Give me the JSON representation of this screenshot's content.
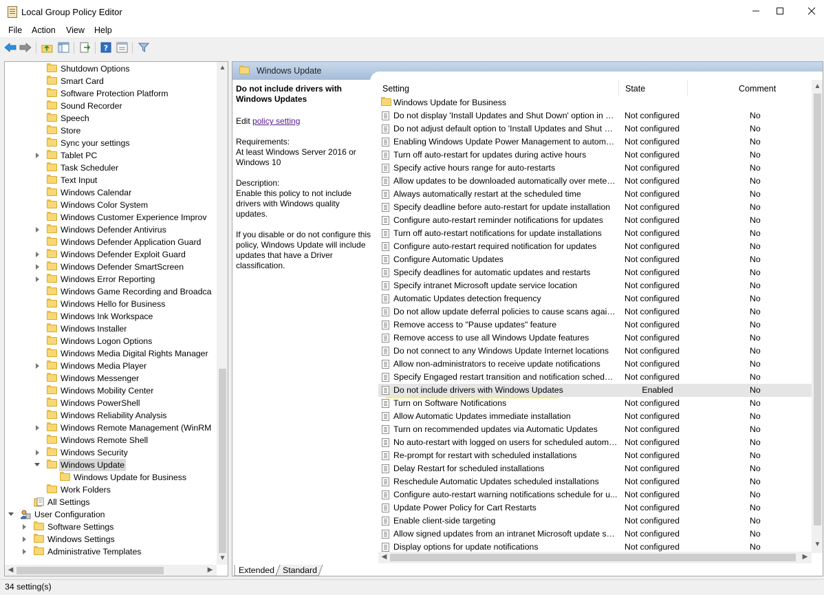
{
  "window": {
    "title": "Local Group Policy Editor"
  },
  "menu": [
    "File",
    "Action",
    "View",
    "Help"
  ],
  "toolbar_icons": [
    "back-arrow-icon",
    "forward-arrow-icon",
    "folder-up-icon",
    "show-hide-tree-icon",
    "export-list-icon",
    "help-icon",
    "properties-icon",
    "filter-icon"
  ],
  "tree": [
    {
      "label": "Shutdown Options",
      "depth": 2,
      "exp": "none"
    },
    {
      "label": "Smart Card",
      "depth": 2,
      "exp": "none"
    },
    {
      "label": "Software Protection Platform",
      "depth": 2,
      "exp": "none"
    },
    {
      "label": "Sound Recorder",
      "depth": 2,
      "exp": "none"
    },
    {
      "label": "Speech",
      "depth": 2,
      "exp": "none"
    },
    {
      "label": "Store",
      "depth": 2,
      "exp": "none"
    },
    {
      "label": "Sync your settings",
      "depth": 2,
      "exp": "none"
    },
    {
      "label": "Tablet PC",
      "depth": 2,
      "exp": "closed"
    },
    {
      "label": "Task Scheduler",
      "depth": 2,
      "exp": "none"
    },
    {
      "label": "Text Input",
      "depth": 2,
      "exp": "none"
    },
    {
      "label": "Windows Calendar",
      "depth": 2,
      "exp": "none"
    },
    {
      "label": "Windows Color System",
      "depth": 2,
      "exp": "none"
    },
    {
      "label": "Windows Customer Experience Improv",
      "depth": 2,
      "exp": "none"
    },
    {
      "label": "Windows Defender Antivirus",
      "depth": 2,
      "exp": "closed"
    },
    {
      "label": "Windows Defender Application Guard",
      "depth": 2,
      "exp": "none"
    },
    {
      "label": "Windows Defender Exploit Guard",
      "depth": 2,
      "exp": "closed"
    },
    {
      "label": "Windows Defender SmartScreen",
      "depth": 2,
      "exp": "closed"
    },
    {
      "label": "Windows Error Reporting",
      "depth": 2,
      "exp": "closed"
    },
    {
      "label": "Windows Game Recording and Broadca",
      "depth": 2,
      "exp": "none"
    },
    {
      "label": "Windows Hello for Business",
      "depth": 2,
      "exp": "none"
    },
    {
      "label": "Windows Ink Workspace",
      "depth": 2,
      "exp": "none"
    },
    {
      "label": "Windows Installer",
      "depth": 2,
      "exp": "none"
    },
    {
      "label": "Windows Logon Options",
      "depth": 2,
      "exp": "none"
    },
    {
      "label": "Windows Media Digital Rights Manager",
      "depth": 2,
      "exp": "none"
    },
    {
      "label": "Windows Media Player",
      "depth": 2,
      "exp": "closed"
    },
    {
      "label": "Windows Messenger",
      "depth": 2,
      "exp": "none"
    },
    {
      "label": "Windows Mobility Center",
      "depth": 2,
      "exp": "none"
    },
    {
      "label": "Windows PowerShell",
      "depth": 2,
      "exp": "none"
    },
    {
      "label": "Windows Reliability Analysis",
      "depth": 2,
      "exp": "none"
    },
    {
      "label": "Windows Remote Management (WinRM",
      "depth": 2,
      "exp": "closed"
    },
    {
      "label": "Windows Remote Shell",
      "depth": 2,
      "exp": "none"
    },
    {
      "label": "Windows Security",
      "depth": 2,
      "exp": "closed"
    },
    {
      "label": "Windows Update",
      "depth": 2,
      "exp": "open",
      "selected": true
    },
    {
      "label": "Windows Update for Business",
      "depth": 3,
      "exp": "none"
    },
    {
      "label": "Work Folders",
      "depth": 2,
      "exp": "none"
    },
    {
      "label": "All Settings",
      "depth": 1,
      "exp": "none",
      "icon": "settings"
    },
    {
      "label": "User Configuration",
      "depth": 0,
      "exp": "open",
      "icon": "user"
    },
    {
      "label": "Software Settings",
      "depth": 1,
      "exp": "closed"
    },
    {
      "label": "Windows Settings",
      "depth": 1,
      "exp": "closed"
    },
    {
      "label": "Administrative Templates",
      "depth": 1,
      "exp": "closed"
    }
  ],
  "right": {
    "header": "Windows Update",
    "extended": {
      "title": "Do not include drivers with Windows Updates",
      "edit_prefix": "Edit ",
      "edit_link": "policy setting ",
      "requirements_label": "Requirements:",
      "requirements": "At least Windows Server 2016 or Windows 10",
      "description_label": "Description:",
      "description": "Enable this policy to not include drivers with Windows quality updates.",
      "description2": "If you disable or do not configure this policy, Windows Update will include updates that have a Driver classification."
    },
    "columns": {
      "setting": "Setting",
      "state": "State",
      "comment": "Comment"
    },
    "folder_row": "Windows Update for Business",
    "rows": [
      {
        "name": "Do not display 'Install Updates and Shut Down' option in Sh...",
        "state": "Not configured",
        "comment": "No"
      },
      {
        "name": "Do not adjust default option to 'Install Updates and Shut Do...",
        "state": "Not configured",
        "comment": "No"
      },
      {
        "name": "Enabling Windows Update Power Management to automati...",
        "state": "Not configured",
        "comment": "No"
      },
      {
        "name": "Turn off auto-restart for updates during active hours",
        "state": "Not configured",
        "comment": "No"
      },
      {
        "name": "Specify active hours range for auto-restarts",
        "state": "Not configured",
        "comment": "No"
      },
      {
        "name": "Allow updates to be downloaded automatically over metere...",
        "state": "Not configured",
        "comment": "No"
      },
      {
        "name": "Always automatically restart at the scheduled time",
        "state": "Not configured",
        "comment": "No"
      },
      {
        "name": "Specify deadline before auto-restart for update installation",
        "state": "Not configured",
        "comment": "No"
      },
      {
        "name": "Configure auto-restart reminder notifications for updates",
        "state": "Not configured",
        "comment": "No"
      },
      {
        "name": "Turn off auto-restart notifications for update installations",
        "state": "Not configured",
        "comment": "No"
      },
      {
        "name": "Configure auto-restart required notification for updates",
        "state": "Not configured",
        "comment": "No"
      },
      {
        "name": "Configure Automatic Updates",
        "state": "Not configured",
        "comment": "No"
      },
      {
        "name": "Specify deadlines for automatic updates and restarts",
        "state": "Not configured",
        "comment": "No"
      },
      {
        "name": "Specify intranet Microsoft update service location",
        "state": "Not configured",
        "comment": "No"
      },
      {
        "name": "Automatic Updates detection frequency",
        "state": "Not configured",
        "comment": "No"
      },
      {
        "name": "Do not allow update deferral policies to cause scans against ...",
        "state": "Not configured",
        "comment": "No"
      },
      {
        "name": "Remove access to \"Pause updates\" feature",
        "state": "Not configured",
        "comment": "No"
      },
      {
        "name": "Remove access to use all Windows Update features",
        "state": "Not configured",
        "comment": "No"
      },
      {
        "name": "Do not connect to any Windows Update Internet locations",
        "state": "Not configured",
        "comment": "No"
      },
      {
        "name": "Allow non-administrators to receive update notifications",
        "state": "Not configured",
        "comment": "No"
      },
      {
        "name": "Specify Engaged restart transition and notification schedule ...",
        "state": "Not configured",
        "comment": "No"
      },
      {
        "name": "Do not include drivers with Windows Updates",
        "state": "Enabled",
        "comment": "No",
        "highlight": true
      },
      {
        "name": "Turn on Software Notifications",
        "state": "Not configured",
        "comment": "No"
      },
      {
        "name": "Allow Automatic Updates immediate installation",
        "state": "Not configured",
        "comment": "No"
      },
      {
        "name": "Turn on recommended updates via Automatic Updates",
        "state": "Not configured",
        "comment": "No"
      },
      {
        "name": "No auto-restart with logged on users for scheduled automat...",
        "state": "Not configured",
        "comment": "No"
      },
      {
        "name": "Re-prompt for restart with scheduled installations",
        "state": "Not configured",
        "comment": "No"
      },
      {
        "name": "Delay Restart for scheduled installations",
        "state": "Not configured",
        "comment": "No"
      },
      {
        "name": "Reschedule Automatic Updates scheduled installations",
        "state": "Not configured",
        "comment": "No"
      },
      {
        "name": "Configure auto-restart warning notifications schedule for u...",
        "state": "Not configured",
        "comment": "No"
      },
      {
        "name": "Update Power Policy for Cart Restarts",
        "state": "Not configured",
        "comment": "No"
      },
      {
        "name": "Enable client-side targeting",
        "state": "Not configured",
        "comment": "No"
      },
      {
        "name": "Allow signed updates from an intranet Microsoft update ser...",
        "state": "Not configured",
        "comment": "No"
      },
      {
        "name": "Display options for update notifications",
        "state": "Not configured",
        "comment": "No"
      }
    ]
  },
  "tabs": [
    "Extended",
    "Standard"
  ],
  "status": "34 setting(s)",
  "colors": {
    "highlight_marker": "#f6ff29",
    "header_gradient": "#b3c7e0",
    "link": "#551a8b"
  }
}
